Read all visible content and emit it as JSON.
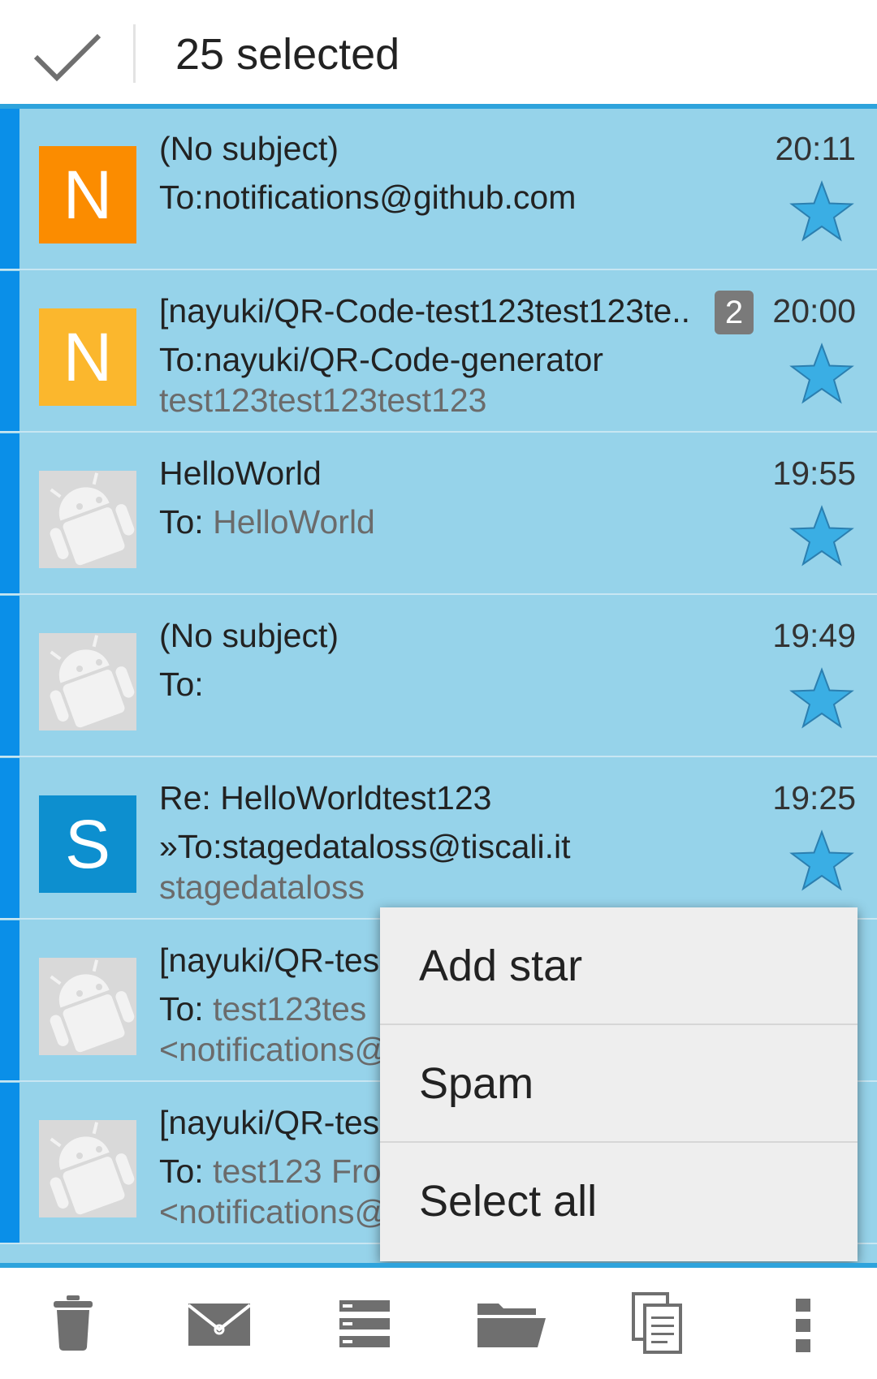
{
  "header": {
    "selected_label": "25 selected"
  },
  "messages": [
    {
      "subject": "(No subject)",
      "to_prefix": "To:",
      "recipient": "notifications@github.com",
      "preview": "",
      "time": "20:11",
      "count": "",
      "avatar": {
        "letter": "N",
        "color": "#fb8c00"
      },
      "starred": true
    },
    {
      "subject": "[nayuki/QR-Code-test123test123te..",
      "to_prefix": "To:",
      "recipient": "nayuki/QR-Code-generator",
      "preview": "test123test123test123",
      "time": "20:00",
      "count": "2",
      "avatar": {
        "letter": "N",
        "color": "#fbb72d"
      },
      "starred": true
    },
    {
      "subject": "HelloWorld",
      "to_prefix": "To: ",
      "recipient": "HelloWorld",
      "preview": "",
      "time": "19:55",
      "count": "",
      "avatar": {
        "letter": "",
        "color": "android-default"
      },
      "starred": true
    },
    {
      "subject": "(No subject)",
      "to_prefix": "To:",
      "recipient": "",
      "preview": "",
      "time": "19:49",
      "count": "",
      "avatar": {
        "letter": "",
        "color": "android-default"
      },
      "starred": true
    },
    {
      "subject": "Re: HelloWorldtest123",
      "to_prefix": "»To:",
      "recipient": "stagedataloss@tiscali.it",
      "preview": "stagedataloss",
      "time": "19:25",
      "count": "",
      "avatar": {
        "letter": "S",
        "color": "#0d8fcf"
      },
      "starred": true
    },
    {
      "subject": "[nayuki/QR-tes",
      "to_prefix": "To: ",
      "recipient": "test123tes",
      "preview": "<notifications@",
      "time": "",
      "count": "",
      "avatar": {
        "letter": "",
        "color": "android-default"
      },
      "starred": false
    },
    {
      "subject": "[nayuki/QR-tes",
      "to_prefix": "To: ",
      "recipient": "test123 Fro",
      "preview": "<notifications@",
      "time": "",
      "count": "",
      "avatar": {
        "letter": "",
        "color": "android-default"
      },
      "starred": false
    }
  ],
  "context_menu": {
    "items": [
      {
        "label": "Add star"
      },
      {
        "label": "Spam"
      },
      {
        "label": "Select all"
      }
    ]
  },
  "bottom_bar": {
    "icons": [
      "trash-icon",
      "mark-read-icon",
      "list-icon",
      "folder-icon",
      "copy-icon",
      "overflow-menu-icon"
    ]
  },
  "colors": {
    "selected_row": "#96d3ea",
    "marker": "#0a8fe8",
    "accent": "#2ea3dc",
    "star": "#3aaee4"
  }
}
